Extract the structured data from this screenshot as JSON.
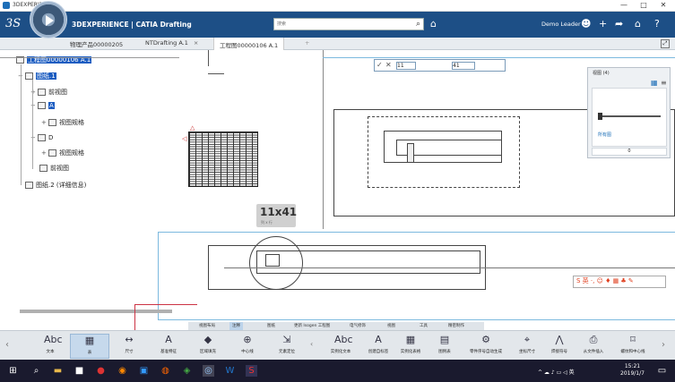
{
  "window": {
    "title": "3DEXPERIENCE",
    "controls": [
      "—",
      "□",
      "✕"
    ]
  },
  "header": {
    "brand": "3DEXPERIENCE | CATIA Drafting",
    "search_placeholder": "搜索",
    "user": "Demo Leader",
    "icons": [
      "search-icon",
      "tag-icon",
      "user-add-icon",
      "plus-icon",
      "share-icon",
      "home-icon",
      "help-icon"
    ]
  },
  "tabs": [
    {
      "label": "物理产品00000205"
    },
    {
      "label": "NTDrafting A.1"
    },
    {
      "label": "工程图00000106 A.1",
      "active": true
    }
  ],
  "tree": {
    "root": "工程图00000106 A.1",
    "items": [
      {
        "label": "图纸.1",
        "selected": true
      },
      {
        "label": "前视图"
      },
      {
        "label": "A"
      },
      {
        "label": "视图规格"
      },
      {
        "label": "D"
      },
      {
        "label": "视图规格"
      },
      {
        "label": "前视图"
      },
      {
        "label": "图纸.2 (详细信息)"
      }
    ]
  },
  "grid_tooltip": {
    "size": "11x41",
    "sub": "列 x 行"
  },
  "float_toolbar": {
    "field1": "11",
    "field2": "41"
  },
  "view_panel": {
    "title": "视图 (4)",
    "label": "所有图",
    "footer": "0"
  },
  "ribbon_tabs": [
    {
      "label": "视图布局"
    },
    {
      "label": "注释",
      "active": true
    },
    {
      "label": "图纸"
    },
    {
      "label": "更新 Isogen 工程图"
    },
    {
      "label": "电气修饰"
    },
    {
      "label": "视图"
    },
    {
      "label": "工具"
    },
    {
      "label": "精密制作"
    }
  ],
  "actions": [
    {
      "label": "文本",
      "icon": "text-icon",
      "glyph": "Abc"
    },
    {
      "label": "表",
      "icon": "table-icon",
      "glyph": "▦",
      "active": true
    },
    {
      "label": "尺寸",
      "icon": "dimension-icon",
      "glyph": "↔"
    },
    {
      "label": "基准特征",
      "icon": "datum-icon",
      "glyph": "A"
    },
    {
      "label": "区域填充",
      "icon": "area-fill-icon",
      "glyph": "◆"
    },
    {
      "label": "中心线",
      "icon": "centerline-icon",
      "glyph": "⊕"
    },
    {
      "label": "元素定位",
      "icon": "element-position-icon",
      "glyph": "⇲"
    },
    {
      "label": "实例化文本",
      "icon": "instantiate-text-icon",
      "glyph": "Abc"
    },
    {
      "label": "创建自标签",
      "icon": "self-label-icon",
      "glyph": "A"
    },
    {
      "label": "实例化表格",
      "icon": "instantiate-table-icon",
      "glyph": "▦"
    },
    {
      "label": "图例表",
      "icon": "legend-table-icon",
      "glyph": "▤"
    },
    {
      "label": "零件序号自动生成",
      "icon": "balloon-auto-icon",
      "glyph": "⚙"
    },
    {
      "label": "坐标尺寸",
      "icon": "coordinate-dim-icon",
      "glyph": "⌖"
    },
    {
      "label": "焊接符号",
      "icon": "weld-symbol-icon",
      "glyph": "⋀"
    },
    {
      "label": "从文件插入",
      "icon": "insert-file-icon",
      "glyph": "⎙"
    },
    {
      "label": "螺纹和中心线",
      "icon": "thread-centerline-icon",
      "glyph": "⌑"
    }
  ],
  "ime_bar": {
    "text": "S 英 ·, ☺ ♦ ▦ ♣ ✎"
  },
  "taskbar": {
    "time": "15:21",
    "date": "2019/1/7",
    "tray": "^ ☁ ♪ ▭ ◁ 英"
  }
}
